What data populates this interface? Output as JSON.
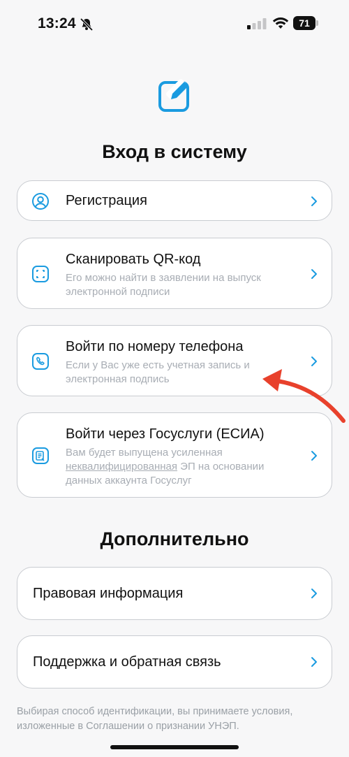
{
  "status_bar": {
    "time": "13:24",
    "battery": "71"
  },
  "login": {
    "title": "Вход в систему",
    "items": [
      {
        "title": "Регистрация",
        "subtitle": ""
      },
      {
        "title": "Сканировать QR-код",
        "subtitle": "Его можно найти в заявлении на выпуск электронной подписи"
      },
      {
        "title": "Войти по номеру телефона",
        "subtitle": "Если у Вас уже есть учетная запись и электронная подпись"
      },
      {
        "title": "Войти через Госуслуги (ЕСИА)",
        "subtitle_before": "Вам будет выпущена усиленная ",
        "subtitle_link": "неквалифицированная",
        "subtitle_after": " ЭП на основании данных аккаунта Госуслуг"
      }
    ]
  },
  "extra": {
    "title": "Дополнительно",
    "items": [
      {
        "title": "Правовая информация"
      },
      {
        "title": "Поддержка и обратная связь"
      }
    ]
  },
  "footer_text": "Выбирая способ идентификации, вы принимаете условия, изложенные в Соглашении о признании УНЭП.",
  "colors": {
    "accent": "#1a9be0",
    "annotation": "#e8412c"
  },
  "icons": [
    "bell-slash-icon",
    "signal-icon",
    "wifi-icon",
    "battery-icon",
    "app-logo-icon",
    "user-icon",
    "qr-scan-icon",
    "phone-icon",
    "gosuslugi-icon",
    "chevron-right-icon"
  ]
}
